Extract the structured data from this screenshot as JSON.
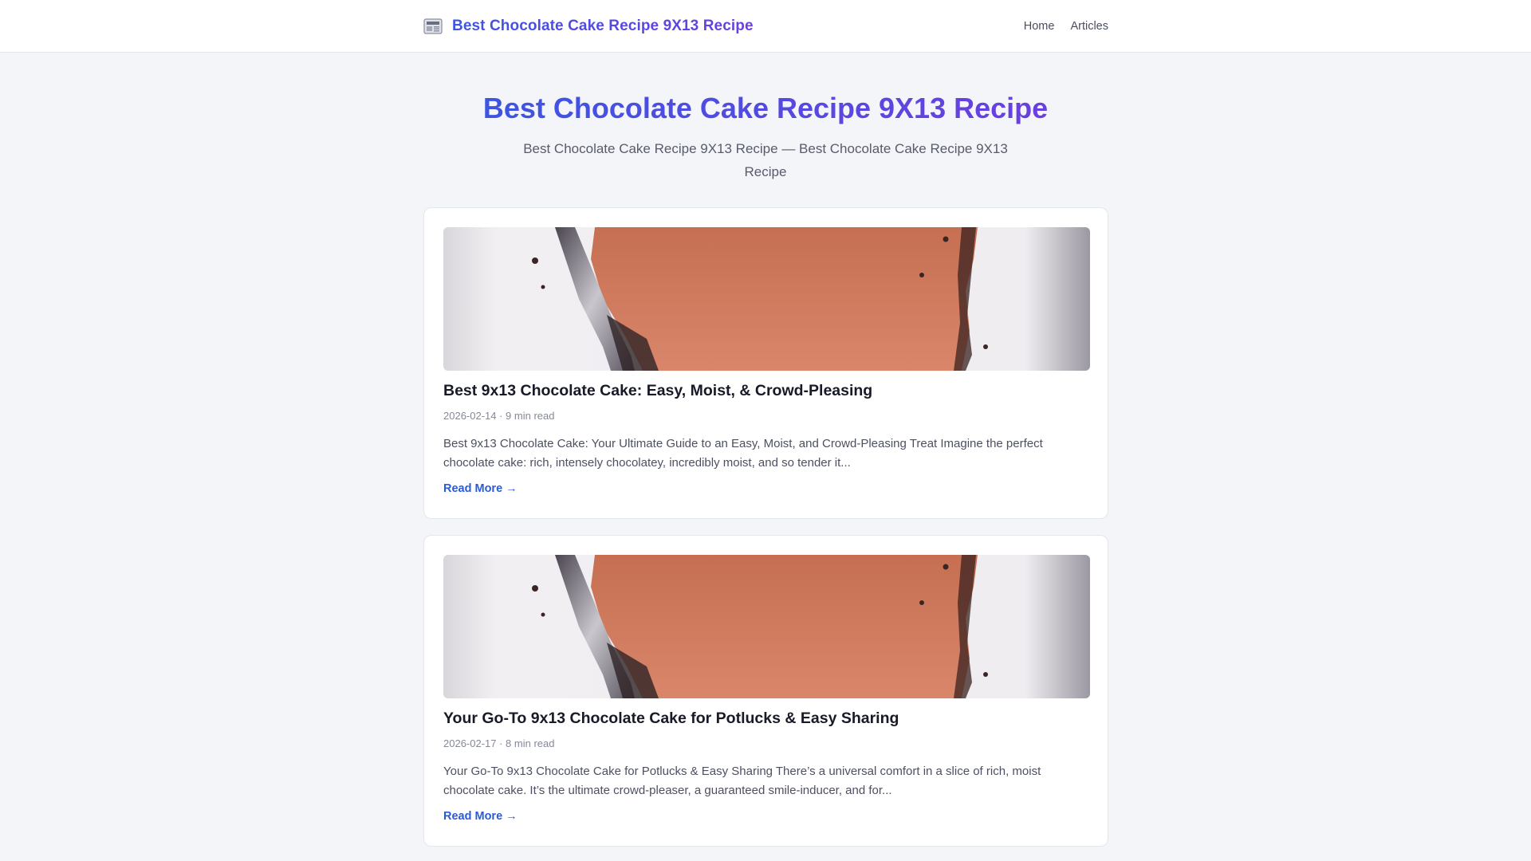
{
  "header": {
    "brand_icon": "newspaper-icon",
    "brand_title": "Best Chocolate Cake Recipe 9X13 Recipe",
    "nav": [
      {
        "label": "Home"
      },
      {
        "label": "Articles"
      }
    ]
  },
  "hero": {
    "title": "Best Chocolate Cake Recipe 9X13 Recipe",
    "subtitle": "Best Chocolate Cake Recipe 9X13 Recipe — Best Chocolate Cake Recipe 9X13 Recipe"
  },
  "articles": [
    {
      "image": "chocolate-cake-slice-photo",
      "title": "Best 9x13 Chocolate Cake: Easy, Moist, & Crowd-Pleasing",
      "meta": "2026-02-14 · 9 min read",
      "excerpt": "Best 9x13 Chocolate Cake: Your Ultimate Guide to an Easy, Moist, and Crowd-Pleasing Treat Imagine the perfect chocolate cake: rich, intensely chocolatey, incredibly moist, and so tender it...",
      "link_label": "Read More →"
    },
    {
      "image": "chocolate-cake-slice-photo",
      "title": "Your Go-To 9x13 Chocolate Cake for Potlucks & Easy Sharing",
      "meta": "2026-02-17 · 8 min read",
      "excerpt": "Your Go-To 9x13 Chocolate Cake for Potlucks & Easy Sharing There’s a universal comfort in a slice of rich, moist chocolate cake. It’s the ultimate crowd-pleaser, a guaranteed smile-inducer, and for...",
      "link_label": "Read More →"
    }
  ],
  "colors": {
    "accent_start": "#3d55e0",
    "accent_end": "#6a3fe0",
    "link": "#2a5bd7",
    "background": "#f4f5f9"
  }
}
